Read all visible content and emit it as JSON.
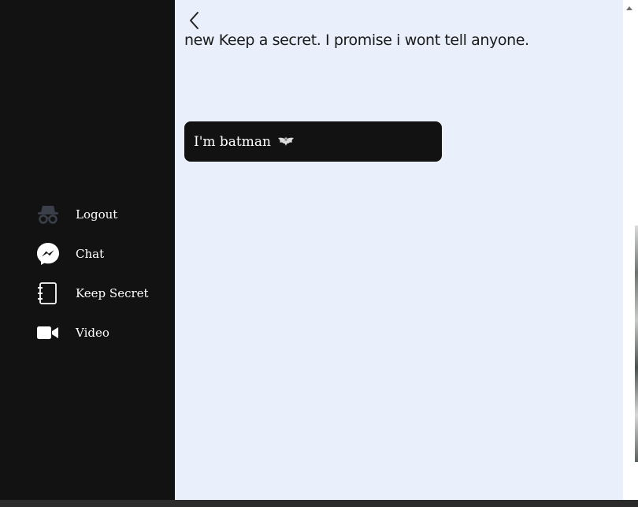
{
  "sidebar": {
    "items": [
      {
        "label": "Logout",
        "icon": "incognito-icon"
      },
      {
        "label": "Chat",
        "icon": "messenger-icon"
      },
      {
        "label": "Keep Secret",
        "icon": "notebook-icon"
      },
      {
        "label": "Video",
        "icon": "video-camera-icon"
      }
    ]
  },
  "main": {
    "heading": "new Keep a secret. I promise i wont tell anyone.",
    "secrets": [
      {
        "text": "I'm batman",
        "icon": "bat-icon"
      }
    ]
  },
  "colors": {
    "sidebar_bg": "#121212",
    "main_bg": "#e9effb",
    "card_bg": "#121212",
    "text_light": "#ffffff",
    "text_dark": "#1a1a1a"
  }
}
